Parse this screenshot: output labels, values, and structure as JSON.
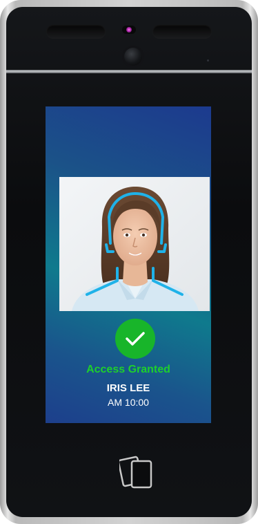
{
  "status": {
    "message": "Access Granted",
    "user_name": "IRIS LEE",
    "time": "AM 10:00"
  },
  "icons": {
    "check": "check-icon",
    "card_reader": "card-reader-icon"
  },
  "colors": {
    "granted_green": "#1ed02b",
    "badge_green": "#18b52a",
    "face_outline": "#1fb2e8",
    "screen_top": "#1c3a8e",
    "screen_mid": "#0f7a8d"
  }
}
